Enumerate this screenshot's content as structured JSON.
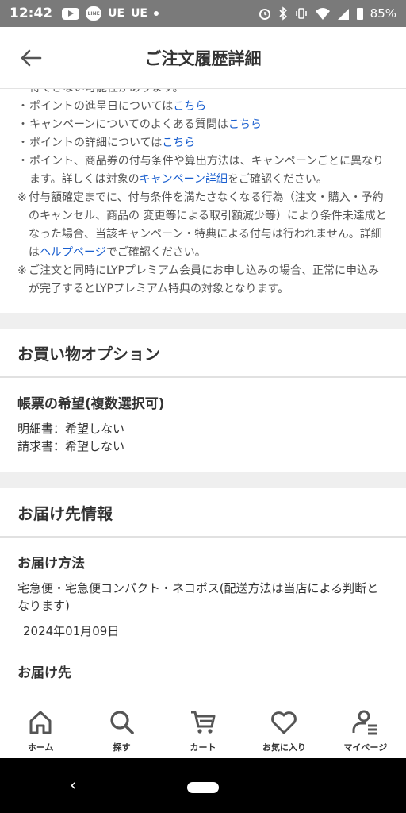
{
  "status_bar": {
    "time": "12:42",
    "left_labels": [
      "UE",
      "UE"
    ],
    "battery": "85%"
  },
  "header": {
    "title": "ご注文履歴詳細"
  },
  "notes": {
    "partial_top": "得できない可能性があります。",
    "items": [
      {
        "mark": "・",
        "text": "ポイントの進呈日については",
        "link": "こちら",
        "after": ""
      },
      {
        "mark": "・",
        "text": "キャンペーンについてのよくある質問は",
        "link": "こちら",
        "after": ""
      },
      {
        "mark": "・",
        "text": "ポイントの詳細については",
        "link": "こちら",
        "after": ""
      },
      {
        "mark": "・",
        "text": "ポイント、商品券の付与条件や算出方法は、キャンペーンごとに異なります。詳しくは対象の",
        "link": "キャンペーン詳細",
        "after": "をご確認ください。"
      },
      {
        "mark": "※",
        "text": "付与額確定までに、付与条件を満たさなくなる行為（注文・購入・予約のキャンセル、商品の 変更等による取引額減少等）により条件未達成となった場合、当該キャンペーン・特典による付与は行われません。詳細は",
        "link": "ヘルプページ",
        "after": "でご確認ください。"
      },
      {
        "mark": "※",
        "text": "ご注文と同時にLYPプレミアム会員にお申し込みの場合、正常に申込みが完了するとLYPプレミアム特典の対象となります。",
        "link": "",
        "after": ""
      }
    ]
  },
  "shopping_options": {
    "section_title": "お買い物オプション",
    "receipt_heading": "帳票の希望(複数選択可)",
    "rows": [
      {
        "label": "明細書：",
        "value": "希望しない"
      },
      {
        "label": "請求書：",
        "value": "希望しない"
      }
    ]
  },
  "delivery": {
    "section_title": "お届け先情報",
    "method_heading": "お届け方法",
    "method_text": "宅急便・宅急便コンパクト・ネコポス(配送方法は当店による判断となります)",
    "date": "2024年01月09日",
    "next_heading": "お届け先"
  },
  "bottom_nav": {
    "items": [
      {
        "label": "ホーム",
        "icon": "home-icon"
      },
      {
        "label": "探す",
        "icon": "search-icon"
      },
      {
        "label": "カート",
        "icon": "cart-icon"
      },
      {
        "label": "お気に入り",
        "icon": "heart-icon"
      },
      {
        "label": "マイページ",
        "icon": "user-icon"
      }
    ]
  },
  "colors": {
    "link": "#1a5fcf",
    "status_bar": "#7a7a7a",
    "section_gap": "#efefef"
  }
}
